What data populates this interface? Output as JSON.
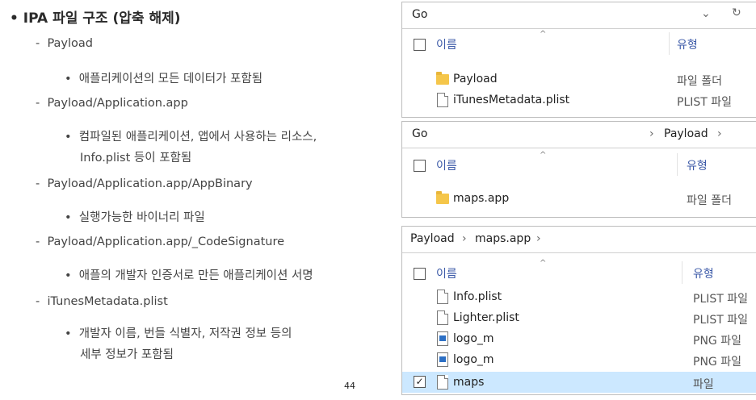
{
  "slide": {
    "title": "IPA 파일 구조 (압축 해제)",
    "page_number": "44",
    "items": [
      {
        "path": "Payload",
        "desc": [
          "애플리케이션의 모든 데이터가 포함됨"
        ]
      },
      {
        "path": "Payload/Application.app",
        "desc": [
          "컴파일된 애플리케이션, 앱에서 사용하는 리소스,",
          "Info.plist 등이 포함됨"
        ]
      },
      {
        "path": "Payload/Application.app/AppBinary",
        "desc": [
          "실행가능한 바이너리 파일"
        ]
      },
      {
        "path": "Payload/Application.app/_CodeSignature",
        "desc": [
          "애플의 개발자 인증서로 만든 애플리케이션 서명"
        ]
      },
      {
        "path": "iTunesMetadata.plist",
        "desc": [
          "개발자 이름, 번들 식별자, 저작권 정보 등의",
          "세부 정보가 포함됨"
        ]
      }
    ]
  },
  "windows": [
    {
      "address": [
        "Go"
      ],
      "header": {
        "name": "이름",
        "type": "유형"
      },
      "rows": [
        {
          "icon": "folder-icon",
          "name": "Payload",
          "type": "파일 폴더"
        },
        {
          "icon": "file-icon",
          "name": "iTunesMetadata.plist",
          "type": "PLIST 파일"
        }
      ]
    },
    {
      "address": [
        "Go",
        "›",
        "Payload",
        "›"
      ],
      "header": {
        "name": "이름",
        "type": "유형"
      },
      "rows": [
        {
          "icon": "folder-icon",
          "name": "maps.app",
          "type": "파일 폴더"
        }
      ]
    },
    {
      "address": [
        "Payload",
        "›",
        "maps.app",
        "›"
      ],
      "header": {
        "name": "이름",
        "type": "유형"
      },
      "rows": [
        {
          "icon": "file-icon",
          "name": "Info.plist",
          "type": "PLIST 파일"
        },
        {
          "icon": "file-icon",
          "name": "Lighter.plist",
          "type": "PLIST 파일"
        },
        {
          "icon": "png-icon",
          "name": "logo_m",
          "type": "PNG 파일"
        },
        {
          "icon": "png-icon",
          "name": "logo_m",
          "type": "PNG 파일"
        },
        {
          "icon": "file-icon",
          "name": "maps",
          "type": "파일",
          "checked": true
        }
      ]
    }
  ],
  "window1_controls": {
    "dropdown": "⌄",
    "refresh": "↻"
  },
  "sort_indicator": "^",
  "checkmark": "✓",
  "colors": {
    "folder": "#f5c64a",
    "selected_row": "#cce8ff",
    "png_icon": "#2c6fc4"
  }
}
